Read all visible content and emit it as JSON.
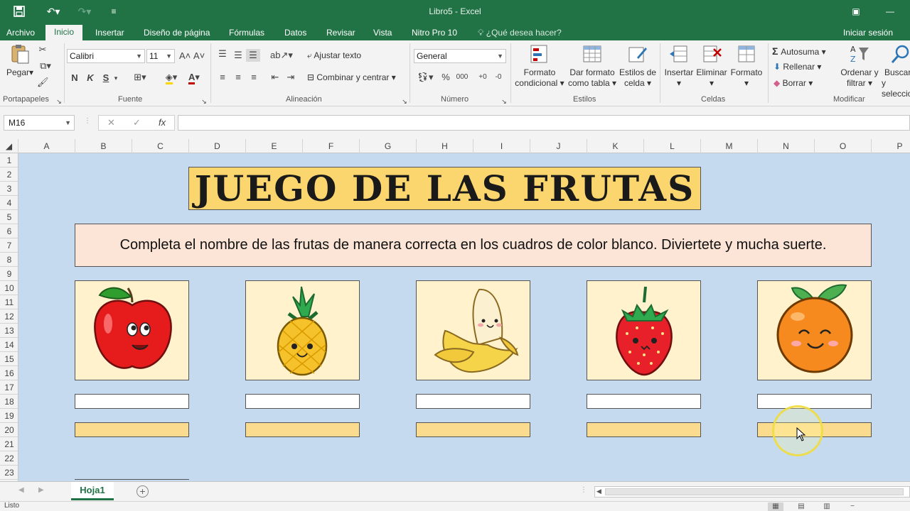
{
  "window": {
    "title": "Libro5 - Excel"
  },
  "quick_access": {
    "customize_glyph": "≡"
  },
  "tabs": [
    "Archivo",
    "Inicio",
    "Insertar",
    "Diseño de página",
    "Fórmulas",
    "Datos",
    "Revisar",
    "Vista",
    "Nitro Pro 10"
  ],
  "tell_me": "¿Qué desea hacer?",
  "sign_in": "Iniciar sesión",
  "ribbon": {
    "clipboard": {
      "paste": "Pegar",
      "label": "Portapapeles"
    },
    "font": {
      "name": "Calibri",
      "size": "11",
      "bold": "N",
      "italic": "K",
      "underline": "S",
      "label": "Fuente"
    },
    "alignment": {
      "wrap": "Ajustar texto",
      "merge": "Combinar y centrar",
      "label": "Alineación"
    },
    "number": {
      "format": "General",
      "percent": "%",
      "thousands": "000",
      "label": "Número"
    },
    "styles": {
      "conditional_1": "Formato",
      "conditional_2": "condicional",
      "table_1": "Dar formato",
      "table_2": "como tabla",
      "cell_1": "Estilos de",
      "cell_2": "celda",
      "label": "Estilos"
    },
    "cells": {
      "insert": "Insertar",
      "delete": "Eliminar",
      "format": "Formato",
      "label": "Celdas"
    },
    "editing": {
      "autosum": "Autosuma",
      "fill": "Rellenar",
      "clear": "Borrar",
      "sort_1": "Ordenar y",
      "sort_2": "filtrar",
      "find_1": "Buscar y",
      "find_2": "seleccionar",
      "label": "Modificar"
    }
  },
  "formula_bar": {
    "name_box": "M16",
    "fx": "fx",
    "cancel": "✕",
    "enter": "✓",
    "value": ""
  },
  "columns": [
    "A",
    "B",
    "C",
    "D",
    "E",
    "F",
    "G",
    "H",
    "I",
    "J",
    "K",
    "L",
    "M",
    "N",
    "O",
    "P"
  ],
  "rows": [
    "1",
    "2",
    "3",
    "4",
    "5",
    "6",
    "7",
    "8",
    "9",
    "10",
    "11",
    "12",
    "13",
    "14",
    "15",
    "16",
    "17",
    "18",
    "19",
    "20",
    "21",
    "22",
    "23"
  ],
  "content": {
    "game_title": "JUEGO DE LAS FRUTAS",
    "instructions": "Completa el nombre de las frutas de manera correcta en los cuadros de color blanco. Diviertete y mucha suerte.",
    "fruits": [
      "apple",
      "pineapple",
      "banana",
      "strawberry",
      "orange"
    ]
  },
  "sheet_tabs": {
    "active": "Hoja1",
    "add": "+"
  },
  "status": {
    "mode": "Listo"
  },
  "colors": {
    "excel_green": "#217346",
    "sheet_bg": "#c5d9ef",
    "title_fill": "#fbd66e",
    "instructions_fill": "#fce4d6",
    "fruit_box_fill": "#fff2cc",
    "answer_yellow": "#fbdc8e"
  }
}
